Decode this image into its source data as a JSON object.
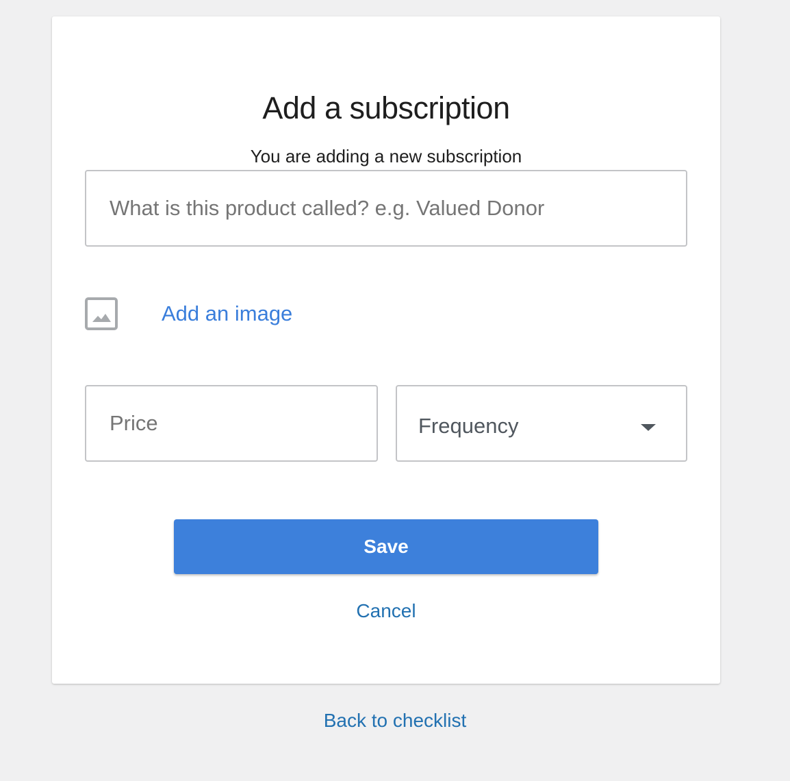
{
  "form": {
    "title": "Add a subscription",
    "subtitle": "You are adding a new subscription",
    "name_placeholder": "What is this product called? e.g. Valued Donor",
    "name_value": "",
    "image_icon": "image-icon",
    "add_image_label": "Add an image",
    "price_placeholder": "Price",
    "price_value": "",
    "frequency_label": "Frequency",
    "frequency_icon": "chevron-down-icon",
    "save_label": "Save",
    "cancel_label": "Cancel"
  },
  "footer": {
    "back_label": "Back to checklist"
  },
  "colors": {
    "background": "#f0f0f1",
    "accent": "#3d80db",
    "link": "#2271b1",
    "image_link": "#3a7edb",
    "border": "#c3c4c7"
  }
}
